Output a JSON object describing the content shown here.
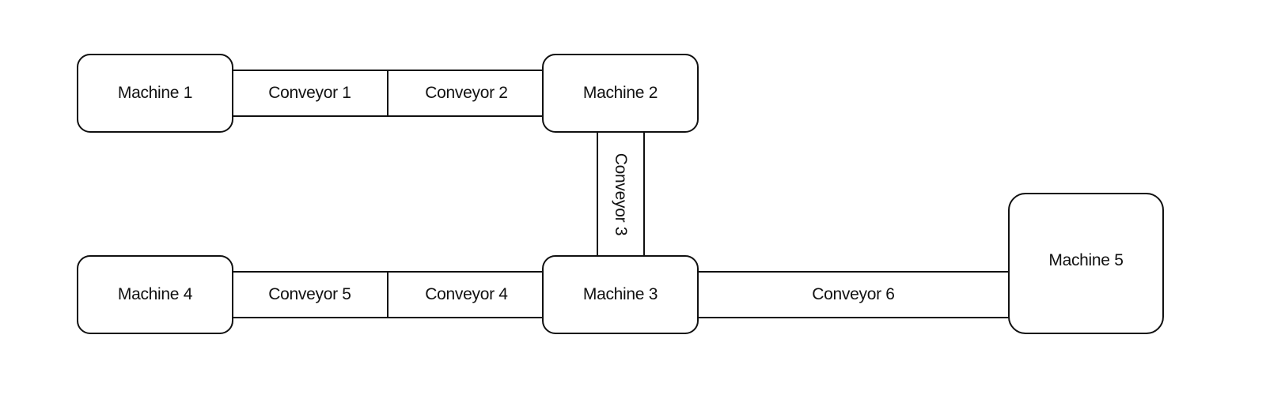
{
  "diagram": {
    "type": "conveyor-layout",
    "machines": [
      {
        "id": "m1",
        "label": "Machine 1"
      },
      {
        "id": "m2",
        "label": "Machine 2"
      },
      {
        "id": "m3",
        "label": "Machine 3"
      },
      {
        "id": "m4",
        "label": "Machine 4"
      },
      {
        "id": "m5",
        "label": "Machine 5"
      }
    ],
    "conveyors": [
      {
        "id": "c1",
        "label": "Conveyor 1"
      },
      {
        "id": "c2",
        "label": "Conveyor 2"
      },
      {
        "id": "c3",
        "label": "Conveyor 3"
      },
      {
        "id": "c4",
        "label": "Conveyor 4"
      },
      {
        "id": "c5",
        "label": "Conveyor 5"
      },
      {
        "id": "c6",
        "label": "Conveyor 6"
      }
    ],
    "connections": [
      {
        "from": "Machine 1",
        "via": [
          "Conveyor 1",
          "Conveyor 2"
        ],
        "to": "Machine 2"
      },
      {
        "from": "Machine 2",
        "via": [
          "Conveyor 3"
        ],
        "to": "Machine 3"
      },
      {
        "from": "Machine 3",
        "via": [
          "Conveyor 4",
          "Conveyor 5"
        ],
        "to": "Machine 4"
      },
      {
        "from": "Machine 3",
        "via": [
          "Conveyor 6"
        ],
        "to": "Machine 5"
      }
    ]
  }
}
